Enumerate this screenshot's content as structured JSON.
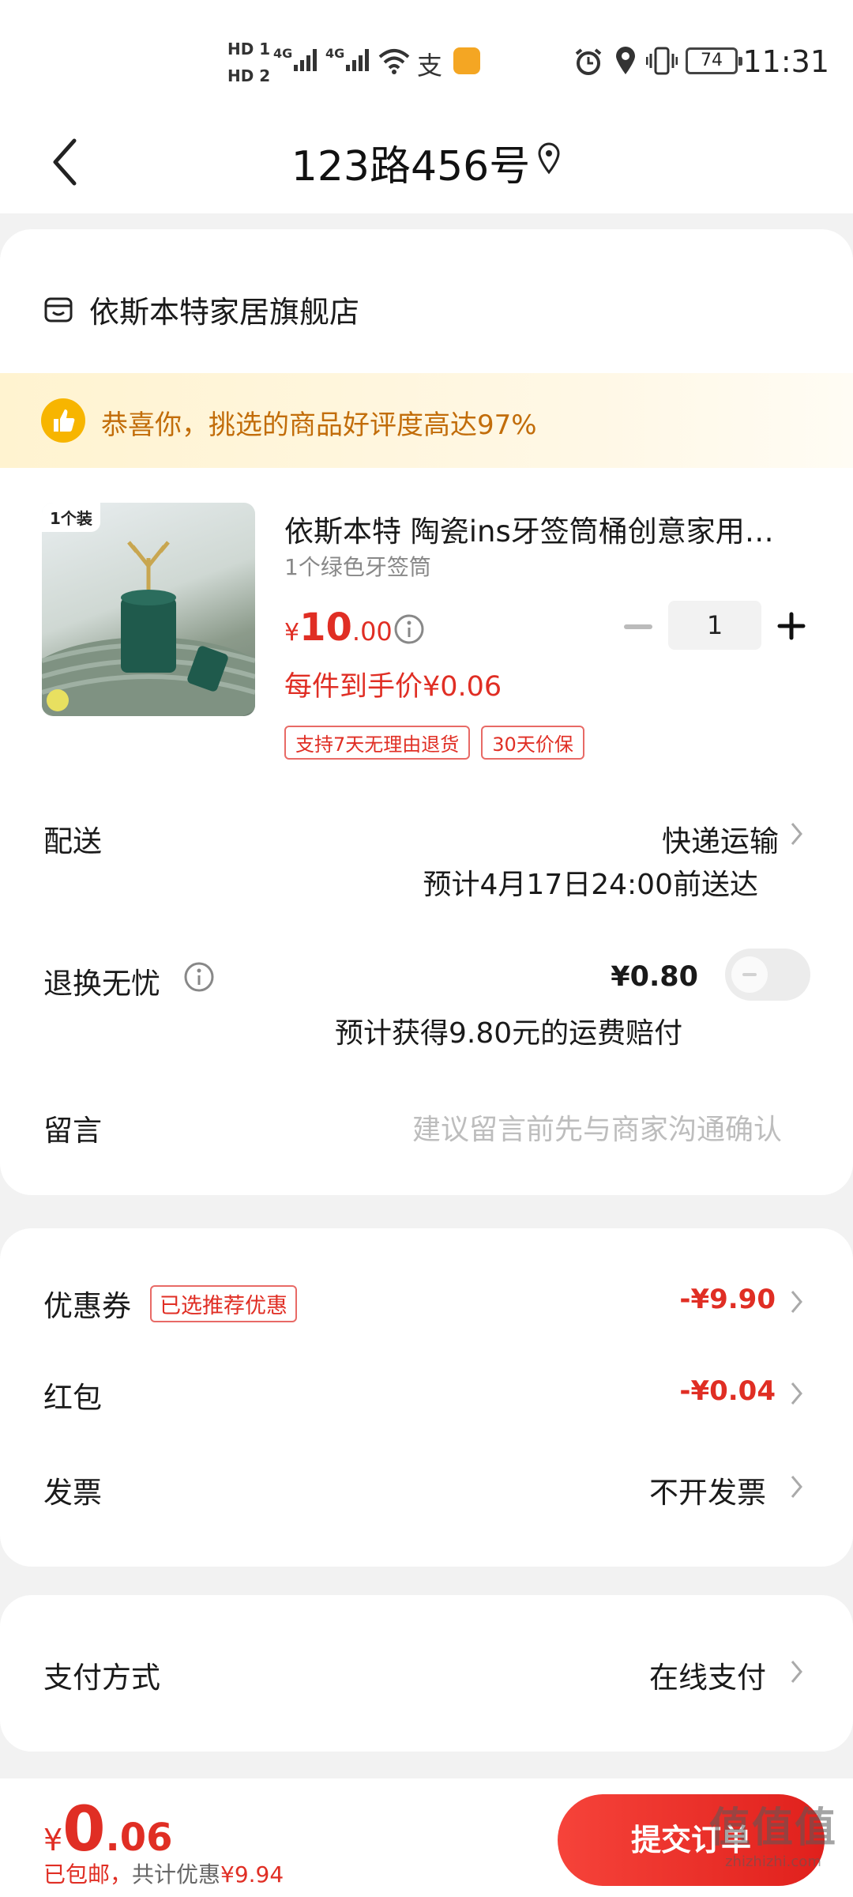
{
  "status_bar": {
    "sim1": "HD 1",
    "sim2": "HD 2",
    "net1": "4G",
    "net2": "4G",
    "battery": "74",
    "time": "11:31"
  },
  "header": {
    "title": "123路456号"
  },
  "store": {
    "name": "依斯本特家居旗舰店"
  },
  "banner": {
    "text": "恭喜你，挑选的商品好评度高达97%"
  },
  "product": {
    "pack_tag": "1个装",
    "title": "依斯本特 陶瓷ins牙签筒桶创意家用…",
    "spec": "1个绿色牙签筒",
    "price_symbol": "¥",
    "price_int": "10",
    "price_dec": ".00",
    "unit_price": "每件到手价¥0.06",
    "tags": [
      "支持7天无理由退货",
      "30天价保"
    ],
    "quantity": "1"
  },
  "delivery": {
    "label": "配送",
    "method": "快递运输",
    "eta": "预计4月17日24:00前送达"
  },
  "return_insurance": {
    "label": "退换无忧",
    "price": "¥0.80",
    "note": "预计获得9.80元的运费赔付",
    "enabled": false
  },
  "message": {
    "label": "留言",
    "placeholder": "建议留言前先与商家沟通确认"
  },
  "discounts": {
    "coupon_label": "优惠券",
    "coupon_badge": "已选推荐优惠",
    "coupon_value": "-¥9.90",
    "redpacket_label": "红包",
    "redpacket_value": "-¥0.04",
    "invoice_label": "发票",
    "invoice_value": "不开发票"
  },
  "payment": {
    "label": "支付方式",
    "value": "在线支付"
  },
  "bottom": {
    "total_symbol": "¥",
    "total_int": "0",
    "total_dec": ".06",
    "shipping_note": "已包邮，",
    "discount_note": "共计优惠",
    "discount_value": "¥9.94",
    "submit_label": "提交订单",
    "watermark": "值值值",
    "watermark_url": "zhizhizhi.com"
  },
  "colors": {
    "accent_red": "#e02e24",
    "banner_text": "#c26d0a"
  }
}
